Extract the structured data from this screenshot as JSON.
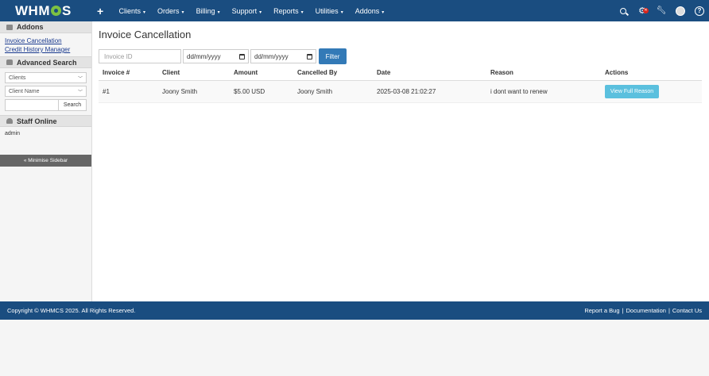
{
  "brand": {
    "logo_left": "WHM",
    "logo_right": "S"
  },
  "nav": {
    "plus": "+",
    "items": [
      {
        "label": "Clients"
      },
      {
        "label": "Orders"
      },
      {
        "label": "Billing"
      },
      {
        "label": "Support"
      },
      {
        "label": "Reports"
      },
      {
        "label": "Utilities"
      },
      {
        "label": "Addons"
      }
    ],
    "caret": "▾",
    "notification_badge": "✕",
    "help": "?"
  },
  "sidebar": {
    "addons_title": "Addons",
    "addons_links": [
      "Invoice Cancellation",
      "Credit History Manager"
    ],
    "advanced_search_title": "Advanced Search",
    "search_type": "Clients",
    "search_field": "Client Name",
    "search_button": "Search",
    "staff_title": "Staff Online",
    "staff_user": "admin",
    "minimise_label": "« Minimise Sidebar"
  },
  "main": {
    "title": "Invoice Cancellation",
    "filters": {
      "invoice_placeholder": "Invoice ID",
      "date_from": "dd/mm/yyyy",
      "date_to": "dd/mm/yyyy",
      "filter_button": "Filter"
    },
    "table": {
      "headers": [
        "Invoice #",
        "Client",
        "Amount",
        "Cancelled By",
        "Date",
        "Reason",
        "Actions"
      ],
      "rows": [
        {
          "invoice": "#1",
          "client": "Joony Smith",
          "amount": "$5.00 USD",
          "cancelled_by": "Joony Smith",
          "date": "2025-03-08 21:02:27",
          "reason": "i dont want to renew",
          "action": "View Full Reason"
        }
      ]
    }
  },
  "footer": {
    "copyright": "Copyright © WHMCS 2025. All Rights Reserved.",
    "links": [
      "Report a Bug",
      "Documentation",
      "Contact Us"
    ],
    "separator": "|"
  },
  "colors": {
    "header": "#1a4d80",
    "accent": "#337ab7",
    "info": "#5bc0de",
    "logo_gear": "#7cc142"
  }
}
